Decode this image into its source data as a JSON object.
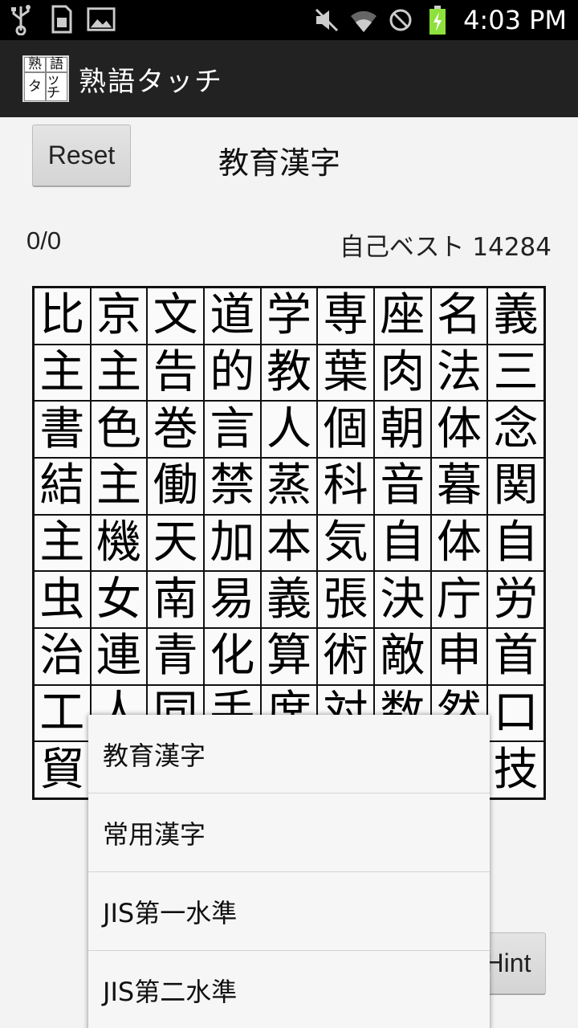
{
  "status_bar": {
    "time": "4:03 PM",
    "icons_left": [
      "usb-icon",
      "sd-card-icon",
      "image-icon"
    ],
    "icons_right": [
      "mute-icon",
      "wifi-icon",
      "no-sign-icon",
      "battery-charging-icon"
    ],
    "battery_color": "#8ee03c"
  },
  "action_bar": {
    "title": "熟語タッチ",
    "icon_chars": [
      "熟",
      "語",
      "タ",
      "ッチ"
    ]
  },
  "controls": {
    "reset_label": "Reset",
    "mode_label": "教育漢字",
    "score": "0/0",
    "best": "自己ベスト 14284",
    "hint_label": "Hint"
  },
  "grid": [
    [
      "比",
      "京",
      "文",
      "道",
      "学",
      "専",
      "座",
      "名",
      "義"
    ],
    [
      "主",
      "主",
      "告",
      "的",
      "教",
      "葉",
      "肉",
      "法",
      "三"
    ],
    [
      "書",
      "色",
      "巻",
      "言",
      "人",
      "個",
      "朝",
      "体",
      "念"
    ],
    [
      "結",
      "主",
      "働",
      "禁",
      "蒸",
      "科",
      "音",
      "暮",
      "関"
    ],
    [
      "主",
      "機",
      "天",
      "加",
      "本",
      "気",
      "自",
      "体",
      "自"
    ],
    [
      "虫",
      "女",
      "南",
      "易",
      "義",
      "張",
      "決",
      "庁",
      "労"
    ],
    [
      "治",
      "連",
      "青",
      "化",
      "算",
      "術",
      "敵",
      "申",
      "首"
    ],
    [
      "工",
      "人",
      "同",
      "手",
      "席",
      "対",
      "数",
      "然",
      "口"
    ],
    [
      "貿",
      "",
      "",
      "",
      "",
      "",
      "",
      "",
      "技"
    ]
  ],
  "dropdown": {
    "options": [
      "教育漢字",
      "常用漢字",
      "JIS第一水準",
      "JIS第二水準"
    ]
  }
}
